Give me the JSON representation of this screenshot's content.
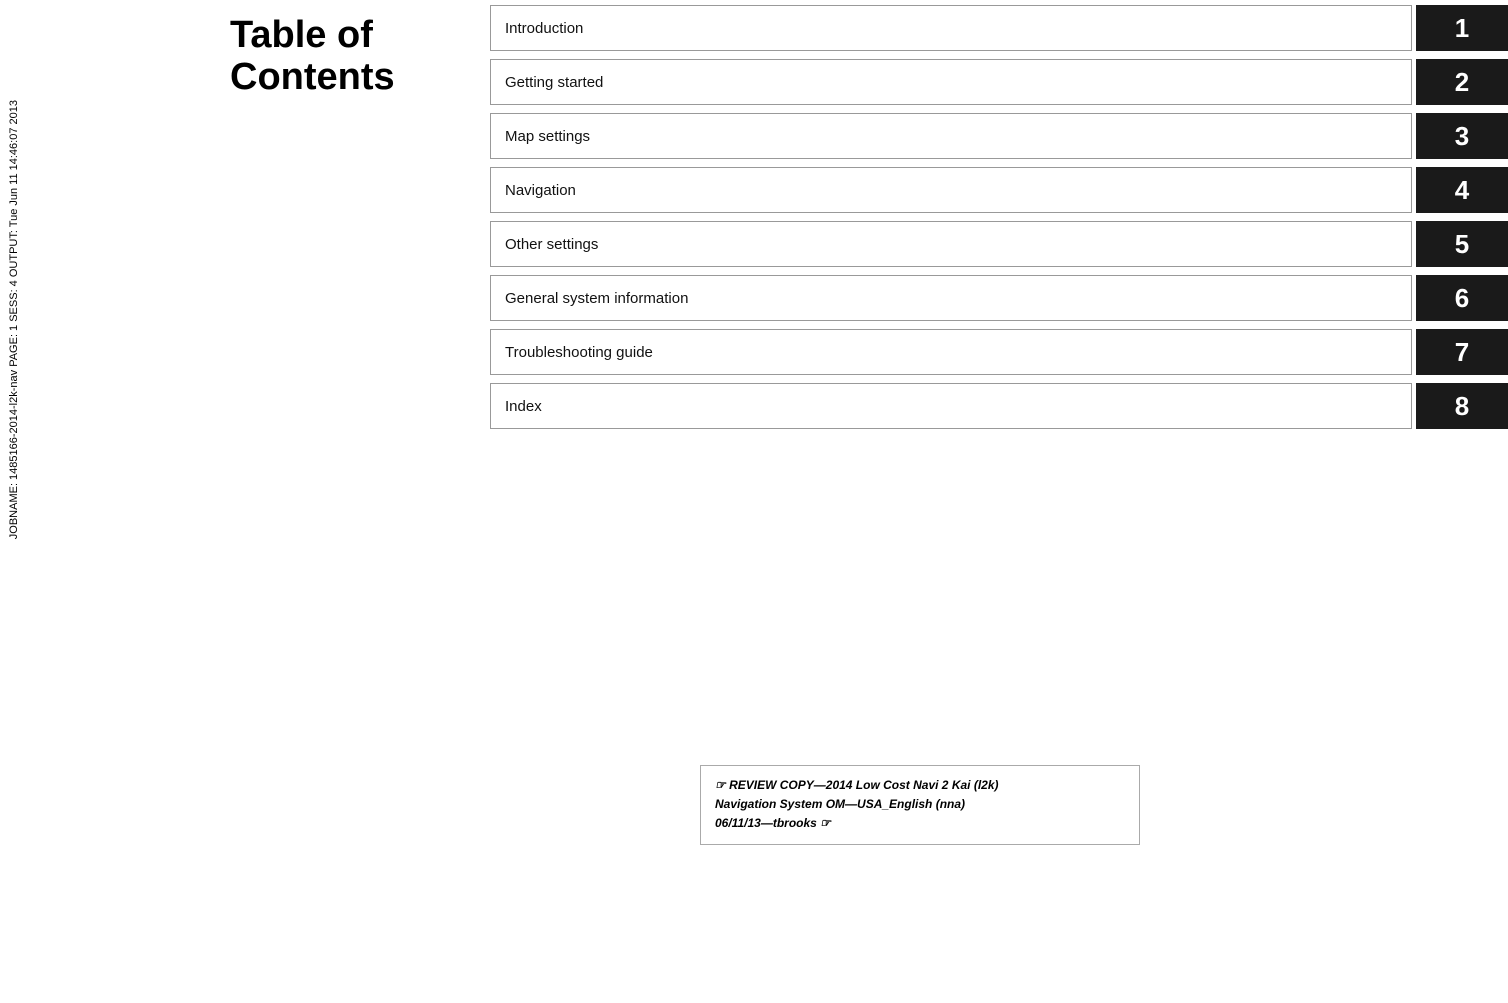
{
  "page": {
    "background": "#ffffff"
  },
  "sidebar": {
    "vertical_text": "JOBNAME: 1485166-2014-l2k-nav  PAGE: 1  SESS: 4  OUTPUT: Tue Jun 11 14:46:07 2013"
  },
  "title": {
    "line1": "Table of",
    "line2": "Contents"
  },
  "toc": {
    "items": [
      {
        "label": "Introduction",
        "number": "1"
      },
      {
        "label": "Getting started",
        "number": "2"
      },
      {
        "label": "Map settings",
        "number": "3"
      },
      {
        "label": "Navigation",
        "number": "4"
      },
      {
        "label": "Other settings",
        "number": "5"
      },
      {
        "label": "General system information",
        "number": "6"
      },
      {
        "label": "Troubleshooting guide",
        "number": "7"
      },
      {
        "label": "Index",
        "number": "8"
      }
    ]
  },
  "review_box": {
    "line1": "☞ REVIEW COPY—2014 Low Cost Navi 2 Kai (l2k)",
    "line2": "Navigation System OM—USA_English (nna)",
    "line3": "06/11/13—tbrooks ☞"
  }
}
